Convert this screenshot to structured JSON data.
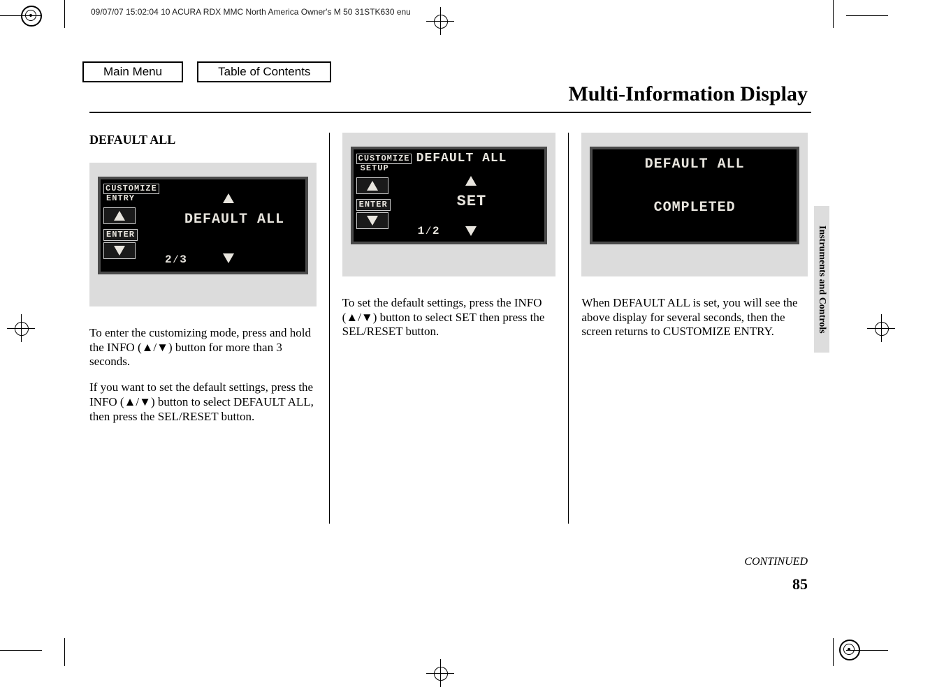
{
  "header": {
    "stamp": "09/07/07 15:02:04   10 ACURA RDX MMC North America Owner's M 50 31STK630 enu"
  },
  "nav": {
    "main_menu": "Main Menu",
    "toc": "Table of Contents"
  },
  "page_title": "Multi-Information Display",
  "side_tab": "Instruments and Controls",
  "col1": {
    "heading": "DEFAULT ALL",
    "screen": {
      "label_top": "CUSTOMIZE",
      "label_sub": "ENTRY",
      "enter": "ENTER",
      "main": "DEFAULT ALL",
      "frac": "2⁄3"
    },
    "p1": "To enter the customizing mode, press and hold the INFO (▲/▼) button for more than 3 seconds.",
    "p2": "If you want to set the default settings, press the INFO (▲/▼) button to select DEFAULT ALL, then press the SEL/RESET button."
  },
  "col2": {
    "screen": {
      "label_top": "CUSTOMIZE",
      "label_sub": "SETUP",
      "enter": "ENTER",
      "title": "DEFAULT ALL",
      "main": "SET",
      "frac": "1⁄2"
    },
    "p1": "To set the default settings, press the INFO (▲/▼) button to select SET then press the SEL/RESET button."
  },
  "col3": {
    "screen": {
      "title": "DEFAULT ALL",
      "main": "COMPLETED"
    },
    "p1": "When DEFAULT ALL is set, you will see the above display for several seconds, then the screen returns to CUSTOMIZE ENTRY."
  },
  "continued": "CONTINUED",
  "page_number": "85"
}
